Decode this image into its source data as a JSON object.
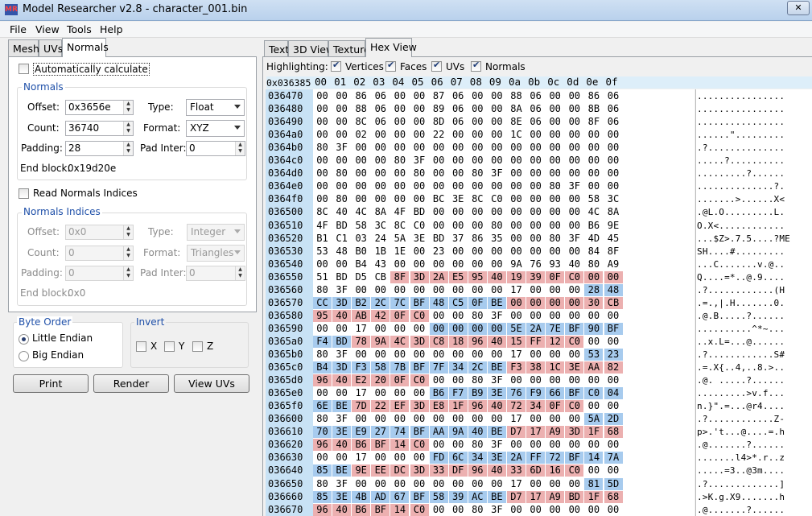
{
  "window": {
    "title": "Model Researcher v2.8 - character_001.bin",
    "icon_text": "MR"
  },
  "menu": [
    "File",
    "View",
    "Tools",
    "Help"
  ],
  "left_tabs": [
    "Mesh",
    "UVs",
    "Normals"
  ],
  "normals_tab": {
    "auto_calc_label": "Automatically calculate",
    "auto_calc_checked": false,
    "normals_group": "Normals",
    "offset_label": "Offset:",
    "offset_value": "0x3656e",
    "count_label": "Count:",
    "count_value": "36740",
    "padding_label": "Padding:",
    "padding_value": "28",
    "type_label": "Type:",
    "type_value": "Float",
    "format_label": "Format:",
    "format_value": "XYZ",
    "padinter_label": "Pad Inter:",
    "padinter_value": "0",
    "endblock_label": "End block:",
    "endblock_value": "0x19d20e",
    "read_indices_label": "Read Normals Indices",
    "read_indices_checked": false,
    "indices_group": "Normals Indices",
    "idx_offset_value": "0x0",
    "idx_count_value": "0",
    "idx_padding_value": "0",
    "idx_type_value": "Integer",
    "idx_format_value": "Triangles",
    "idx_padinter_value": "0",
    "idx_endblock_value": "0x0"
  },
  "byte_order": {
    "title": "Byte Order",
    "options": [
      "Little Endian",
      "Big Endian"
    ],
    "selected": "Little Endian"
  },
  "invert": {
    "title": "Invert",
    "x": "X",
    "y": "Y",
    "z": "Z"
  },
  "buttons": {
    "print": "Print",
    "render": "Render",
    "view_uvs": "View UVs"
  },
  "right_tabs": [
    "Text",
    "3D View",
    "Texture",
    "Hex View"
  ],
  "highlighting": {
    "label": "Highlighting:",
    "items": [
      "Vertices",
      "Faces",
      "UVs",
      "Normals"
    ]
  },
  "hex": {
    "base_addr": "0x036385",
    "columns": [
      "00",
      "01",
      "02",
      "03",
      "04",
      "05",
      "06",
      "07",
      "08",
      "09",
      "0a",
      "0b",
      "0c",
      "0d",
      "0e",
      "0f"
    ],
    "rows": [
      {
        "addr": "036470",
        "bytes": "00 00 86 06 00 00 87 06 00 00 88 06 00 00 86 06",
        "hl": "",
        "ascii": "................"
      },
      {
        "addr": "036480",
        "bytes": "00 00 88 06 00 00 89 06 00 00 8A 06 00 00 8B 06",
        "hl": "",
        "ascii": "................"
      },
      {
        "addr": "036490",
        "bytes": "00 00 8C 06 00 00 8D 06 00 00 8E 06 00 00 8F 06",
        "hl": "",
        "ascii": "................"
      },
      {
        "addr": "0364a0",
        "bytes": "00 00 02 00 00 00 22 00 00 00 1C 00 00 00 00 00",
        "hl": "",
        "ascii": "......\"........."
      },
      {
        "addr": "0364b0",
        "bytes": "80 3F 00 00 00 00 00 00 00 00 00 00 00 00 00 00",
        "hl": "",
        "ascii": ".?.............."
      },
      {
        "addr": "0364c0",
        "bytes": "00 00 00 00 80 3F 00 00 00 00 00 00 00 00 00 00",
        "hl": "",
        "ascii": ".....?.........."
      },
      {
        "addr": "0364d0",
        "bytes": "00 80 00 00 00 80 00 00 80 3F 00 00 00 00 00 00",
        "hl": "",
        "ascii": ".........?......"
      },
      {
        "addr": "0364e0",
        "bytes": "00 00 00 00 00 00 00 00 00 00 00 00 80 3F 00 00",
        "hl": "",
        "ascii": "..............?."
      },
      {
        "addr": "0364f0",
        "bytes": "00 80 00 00 00 00 BC 3E 8C C0 00 00 00 00 58 3C",
        "hl": "",
        "ascii": ".......>......X<"
      },
      {
        "addr": "036500",
        "bytes": "8C 40 4C 8A 4F BD 00 00 00 00 00 00 00 00 4C 8A",
        "hl": "",
        "ascii": ".@L.O.........L."
      },
      {
        "addr": "036510",
        "bytes": "4F BD 58 3C 8C C0 00 00 00 80 00 00 00 00 B6 9E",
        "hl": "",
        "ascii": "O.X<............"
      },
      {
        "addr": "036520",
        "bytes": "B1 C1 03 24 5A 3E BD 37 86 35 00 00 80 3F 4D 45",
        "hl": "",
        "ascii": "...$Z>.7.5....?ME"
      },
      {
        "addr": "036530",
        "bytes": "53 48 B0 1B 1E 00 23 00 00 00 00 00 00 00 84 8F",
        "hl": "",
        "ascii": "SH....#........."
      },
      {
        "addr": "036540",
        "bytes": "00 00 B4 43 00 00 00 00 00 00 9A 76 93 40 80 A9",
        "hl": "",
        "ascii": "...C.......v.@.."
      },
      {
        "addr": "036550",
        "bytes": "51 BD D5 CB 8F 3D 2A E5 95 40 19 39 0F C0 00 00",
        "hl": "....uuuuuuuuuuuu..",
        "ascii": "Q....=*..@.9...."
      },
      {
        "addr": "036560",
        "bytes": "80 3F 00 00 00 00 00 00 00 00 17 00 00 00 28 48",
        "hl": "..............nn",
        "ascii": ".?............(H"
      },
      {
        "addr": "036570",
        "bytes": "CC 3D B2 2C 7C BF 48 C5 0F BE 00 00 00 00 30 CB",
        "hl": "nnnnnnnnnnuuuuuu",
        "ascii": ".=.,|.H.......0."
      },
      {
        "addr": "036580",
        "bytes": "95 40 AB 42 0F C0 00 00 80 3F 00 00 00 00 00 00",
        "hl": "uuuuuu..........",
        "ascii": ".@.B.....?......"
      },
      {
        "addr": "036590",
        "bytes": "00 00 17 00 00 00 00 00 00 00 5E 2A 7E BF 90 BF",
        "hl": "......nnnnnnnnnn",
        "ascii": "..........^*~..."
      },
      {
        "addr": "0365a0",
        "bytes": "F4 BD 78 9A 4C 3D C8 18 96 40 15 FF 12 C0 00 00",
        "hl": "nnuuuuuuuuuuuu..",
        "ascii": "..x.L=...@......"
      },
      {
        "addr": "0365b0",
        "bytes": "80 3F 00 00 00 00 00 00 00 00 17 00 00 00 53 23",
        "hl": "..............nn",
        "ascii": ".?............S#"
      },
      {
        "addr": "0365c0",
        "bytes": "B4 3D F3 58 7B BF 7F 34 2C BE F3 38 1C 3E AA 82",
        "hl": "nnnnnnnnnnuuuuuu",
        "ascii": ".=.X{..4,..8.>.."
      },
      {
        "addr": "0365d0",
        "bytes": "96 40 E2 20 0F C0 00 00 80 3F 00 00 00 00 00 00",
        "hl": "uuuuuu..........",
        "ascii": ".@. .....?......"
      },
      {
        "addr": "0365e0",
        "bytes": "00 00 17 00 00 00 B6 F7 B9 3E 76 F9 66 BF C0 04",
        "hl": "......nnnnnnnnnn",
        "ascii": ".........>v.f..."
      },
      {
        "addr": "0365f0",
        "bytes": "6E BE 7D 22 EF 3D E8 1F 96 40 72 34 0F C0 00 00",
        "hl": "nnuuuuuuuuuuuu..",
        "ascii": "n.}\".=...@r4...."
      },
      {
        "addr": "036600",
        "bytes": "80 3F 00 00 00 00 00 00 00 00 17 00 00 00 5A 2D",
        "hl": "..............nn",
        "ascii": ".?............Z-"
      },
      {
        "addr": "036610",
        "bytes": "70 3E E9 27 74 BF AA 9A 40 BE D7 17 A9 3D 1F 68",
        "hl": "nnnnnnnnnnuuuuuu",
        "ascii": "p>.'t...@....=.h"
      },
      {
        "addr": "036620",
        "bytes": "96 40 B6 BF 14 C0 00 00 80 3F 00 00 00 00 00 00",
        "hl": "uuuuuu..........",
        "ascii": ".@.......?......"
      },
      {
        "addr": "036630",
        "bytes": "00 00 17 00 00 00 FD 6C 34 3E 2A FF 72 BF 14 7A",
        "hl": "......nnnnnnnnnn",
        "ascii": ".......l4>*.r..z"
      },
      {
        "addr": "036640",
        "bytes": "85 BE 9E EE DC 3D 33 DF 96 40 33 6D 16 C0 00 00",
        "hl": "nnuuuuuuuuuuuu..",
        "ascii": ".....=3..@3m...."
      },
      {
        "addr": "036650",
        "bytes": "80 3F 00 00 00 00 00 00 00 00 17 00 00 00 81 5D",
        "hl": "..............nn",
        "ascii": ".?.............]"
      },
      {
        "addr": "036660",
        "bytes": "85 3E 4B AD 67 BF 58 39 AC BE D7 17 A9 BD 1F 68",
        "hl": "nnnnnnnnnnuuuuuu",
        "ascii": ".>K.g.X9.......h"
      },
      {
        "addr": "036670",
        "bytes": "96 40 B6 BF 14 C0 00 00 80 3F 00 00 00 00 00 00",
        "hl": "uuuuuu..........",
        "ascii": ".@.......?......"
      }
    ]
  }
}
